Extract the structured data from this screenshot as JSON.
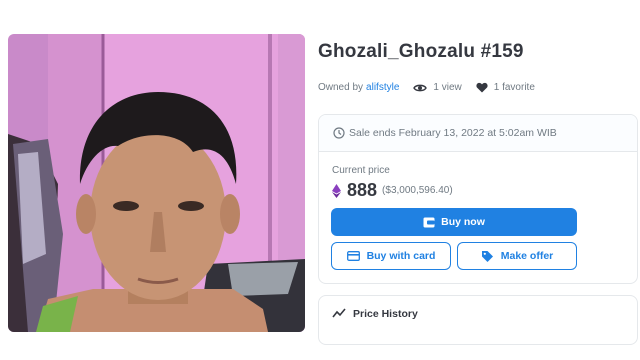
{
  "item": {
    "title": "Ghozali_Ghozalu #159",
    "owned_by_label": "Owned by",
    "owner": "alifstyle",
    "views": "1 view",
    "favorites": "1 favorite"
  },
  "sale": {
    "ends_text": "Sale ends February 13, 2022 at 5:02am WIB",
    "current_price_label": "Current price",
    "price_eth": "888",
    "price_usd": "($3,000,596.40)"
  },
  "actions": {
    "buy_now": "Buy now",
    "buy_with_card": "Buy with card",
    "make_offer": "Make offer"
  },
  "sections": {
    "price_history": "Price History"
  },
  "colors": {
    "accent": "#2081e2",
    "text": "#353840",
    "muted": "#707a83",
    "border": "#e5e8eb"
  },
  "icons": [
    "eye-icon",
    "heart-icon",
    "clock-icon",
    "ethereum-icon",
    "wallet-icon",
    "card-icon",
    "tag-icon",
    "trend-line-icon"
  ]
}
